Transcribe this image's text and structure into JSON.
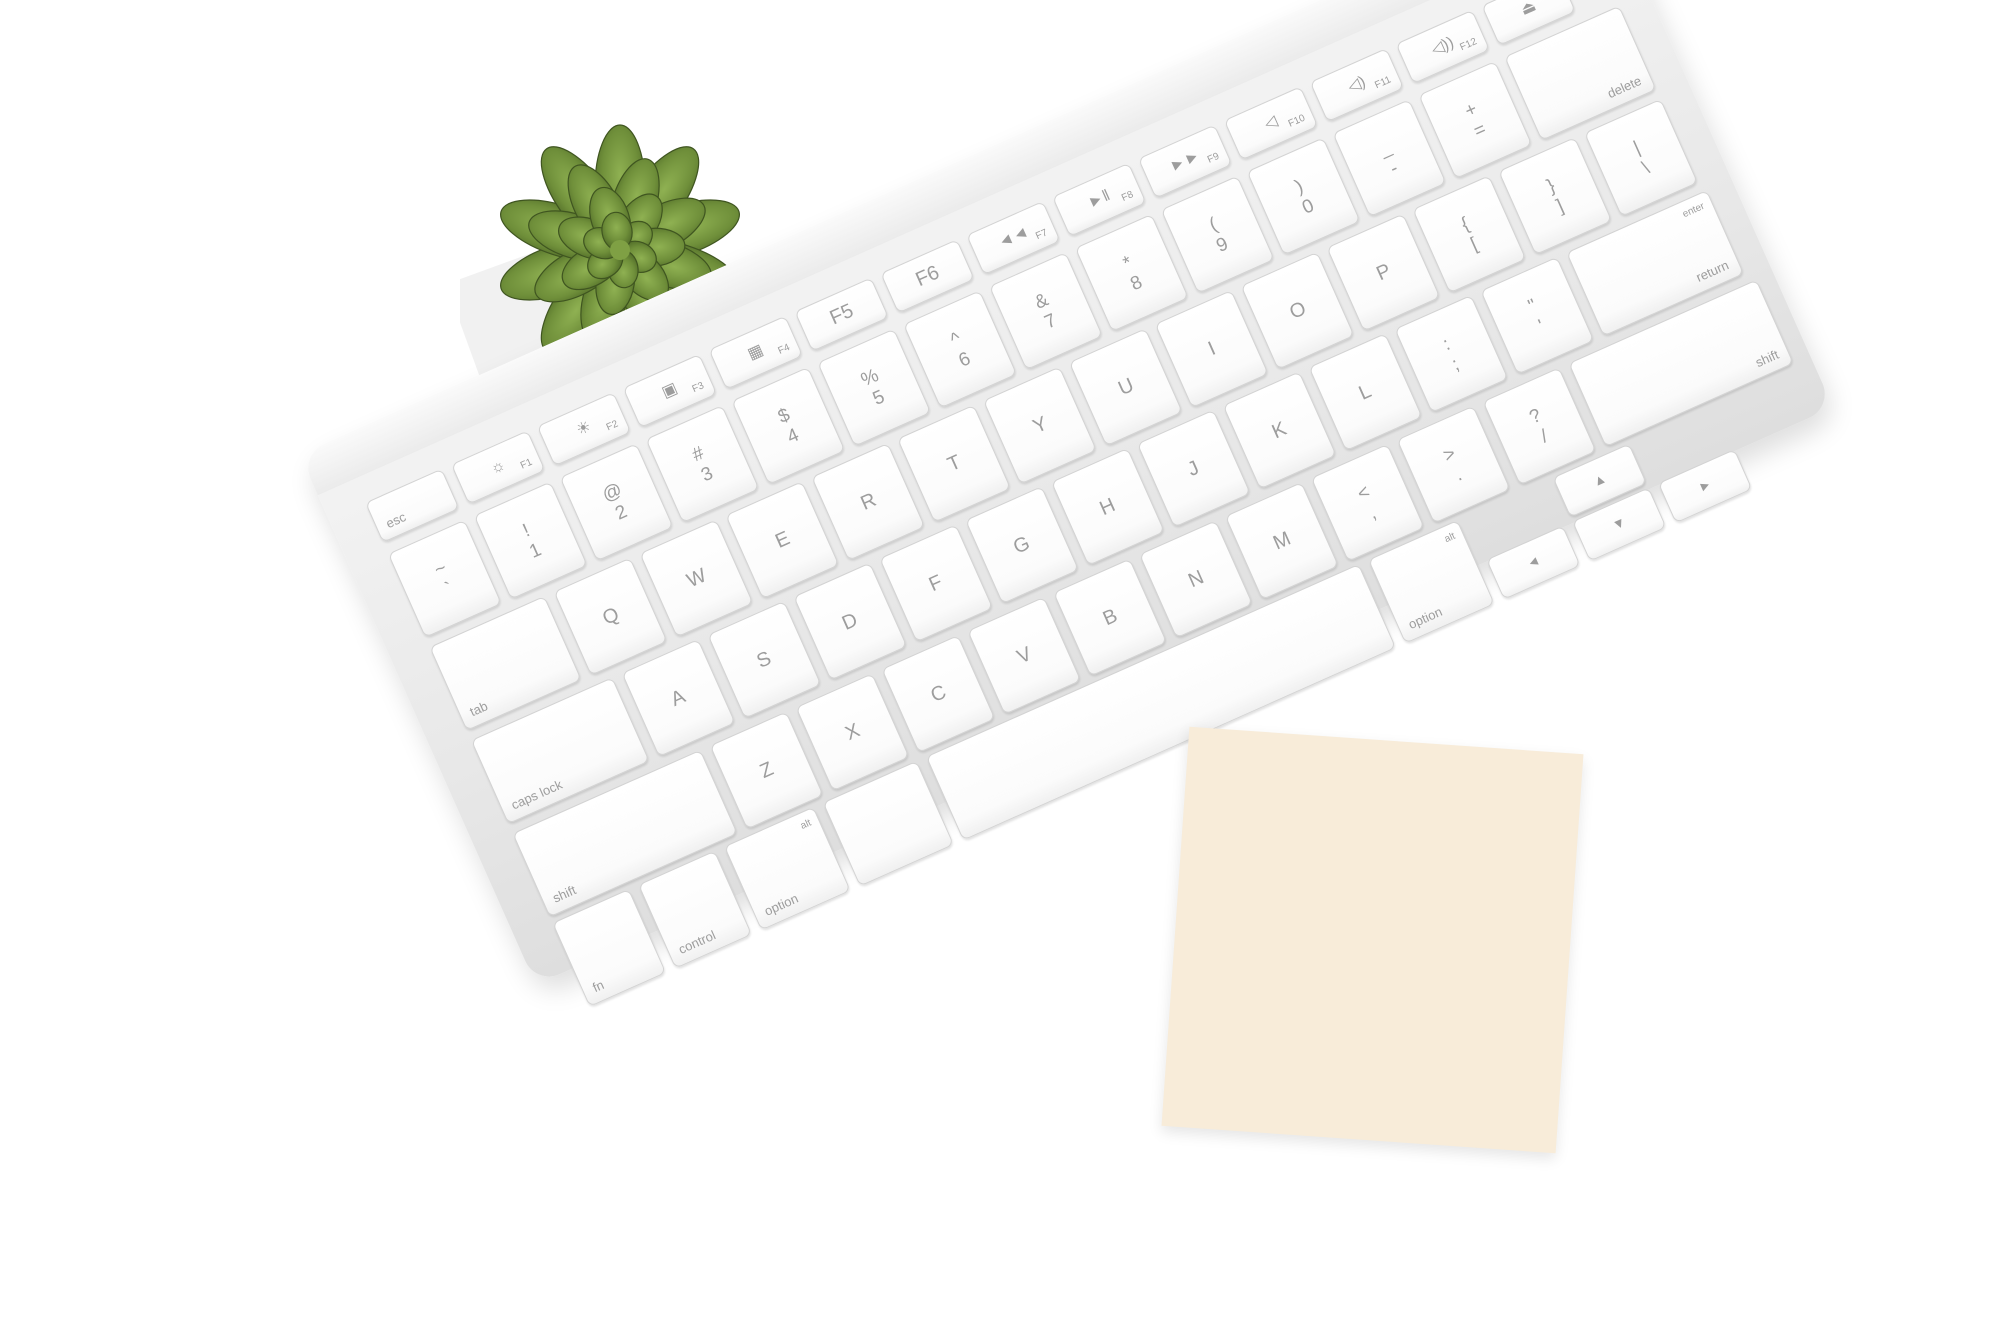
{
  "colors": {
    "background": "#ffffff",
    "keyboard_body": "#ebebeb",
    "key_face": "#ffffff",
    "key_legend": "#9d9d9d",
    "sticky_note": "#f8ecd9",
    "succulent": "#6f8f3a"
  },
  "keyboard": {
    "rows": [
      [
        {
          "label": "esc",
          "style": "word"
        },
        {
          "label": "F1",
          "icon": "brightness-down-icon"
        },
        {
          "label": "F2",
          "icon": "brightness-up-icon"
        },
        {
          "label": "F3",
          "icon": "mission-control-icon"
        },
        {
          "label": "F4",
          "icon": "launchpad-icon"
        },
        {
          "label": "F5"
        },
        {
          "label": "F6"
        },
        {
          "label": "F7",
          "icon": "rewind-icon"
        },
        {
          "label": "F8",
          "icon": "play-pause-icon"
        },
        {
          "label": "F9",
          "icon": "fast-forward-icon"
        },
        {
          "label": "F10",
          "icon": "mute-icon"
        },
        {
          "label": "F11",
          "icon": "volume-down-icon"
        },
        {
          "label": "F12",
          "icon": "volume-up-icon"
        },
        {
          "label": "",
          "icon": "eject-icon"
        }
      ],
      [
        {
          "top": "~",
          "bot": "`"
        },
        {
          "top": "!",
          "bot": "1"
        },
        {
          "top": "@",
          "bot": "2"
        },
        {
          "top": "#",
          "bot": "3"
        },
        {
          "top": "$",
          "bot": "4"
        },
        {
          "top": "%",
          "bot": "5"
        },
        {
          "top": "^",
          "bot": "6"
        },
        {
          "top": "&",
          "bot": "7"
        },
        {
          "top": "*",
          "bot": "8"
        },
        {
          "top": "(",
          "bot": "9"
        },
        {
          "top": ")",
          "bot": "0"
        },
        {
          "top": "_",
          "bot": "-"
        },
        {
          "top": "+",
          "bot": "="
        },
        {
          "label": "delete",
          "style": "word-r"
        }
      ],
      [
        {
          "label": "tab",
          "style": "word"
        },
        {
          "label": "Q"
        },
        {
          "label": "W"
        },
        {
          "label": "E"
        },
        {
          "label": "R"
        },
        {
          "label": "T"
        },
        {
          "label": "Y"
        },
        {
          "label": "U"
        },
        {
          "label": "I"
        },
        {
          "label": "O"
        },
        {
          "label": "P"
        },
        {
          "top": "{",
          "bot": "["
        },
        {
          "top": "}",
          "bot": "]"
        },
        {
          "top": "|",
          "bot": "\\"
        }
      ],
      [
        {
          "label": "caps lock",
          "style": "word"
        },
        {
          "label": "A"
        },
        {
          "label": "S"
        },
        {
          "label": "D"
        },
        {
          "label": "F"
        },
        {
          "label": "G"
        },
        {
          "label": "H"
        },
        {
          "label": "J"
        },
        {
          "label": "K"
        },
        {
          "label": "L"
        },
        {
          "top": ":",
          "bot": ";"
        },
        {
          "top": "\"",
          "bot": "'"
        },
        {
          "label": "return",
          "small": "enter",
          "style": "word-r"
        }
      ],
      [
        {
          "label": "shift",
          "style": "word"
        },
        {
          "label": "Z"
        },
        {
          "label": "X"
        },
        {
          "label": "C"
        },
        {
          "label": "V"
        },
        {
          "label": "B"
        },
        {
          "label": "N"
        },
        {
          "label": "M"
        },
        {
          "top": "<",
          "bot": ","
        },
        {
          "top": ">",
          "bot": "."
        },
        {
          "top": "?",
          "bot": "/"
        },
        {
          "label": "shift",
          "style": "word-r"
        }
      ],
      [
        {
          "label": "fn",
          "style": "word"
        },
        {
          "label": "control",
          "style": "word"
        },
        {
          "label": "option",
          "small": "alt",
          "style": "word"
        },
        {
          "label": "",
          "style": "word"
        },
        {
          "label": ""
        },
        {
          "label": "option",
          "small": "alt",
          "style": "word"
        },
        {
          "label": "",
          "icon": "arrow-left-icon"
        },
        {
          "label": "",
          "icon": "arrow-up-icon"
        },
        {
          "label": "",
          "icon": "arrow-down-icon"
        },
        {
          "label": "",
          "icon": "arrow-right-icon"
        }
      ]
    ]
  }
}
